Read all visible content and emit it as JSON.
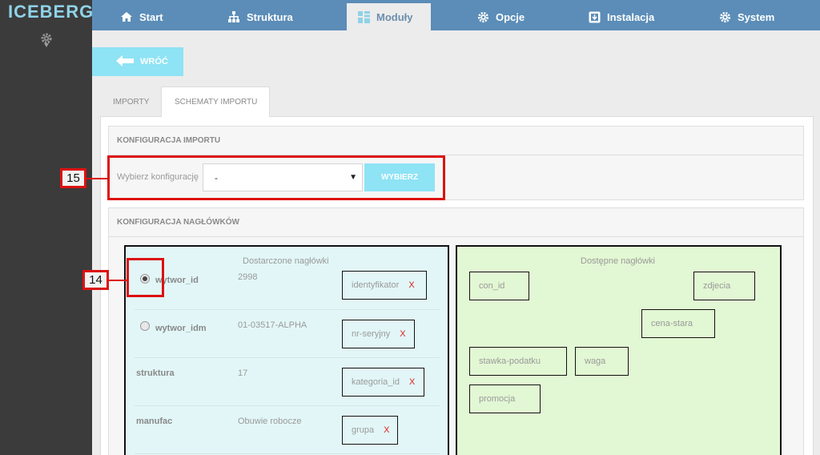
{
  "sidebar": {
    "logo": "ICEBERG",
    "icon": "gear-icon"
  },
  "nav": {
    "items": [
      {
        "label": "Start",
        "icon": "home-icon"
      },
      {
        "label": "Struktura",
        "icon": "sitemap-icon"
      },
      {
        "label": "Moduły",
        "icon": "grid-icon",
        "active": true
      },
      {
        "label": "Opcje",
        "icon": "gear-icon"
      },
      {
        "label": "Instalacja",
        "icon": "install-icon"
      },
      {
        "label": "System",
        "icon": "gear-icon"
      }
    ]
  },
  "back": {
    "label": "WRÓĆ"
  },
  "tabs": [
    {
      "label": "IMPORTY"
    },
    {
      "label": "SCHEMATY IMPORTU",
      "active": true
    }
  ],
  "import_config": {
    "title": "KONFIGURACJA IMPORTU",
    "select_label": "Wybierz konfigurację",
    "select_value": "-",
    "button_label": "WYBIERZ"
  },
  "headers_config": {
    "title": "KONFIGURACJA NAGŁÓWKÓW",
    "provided_title": "Dostarczone nagłówki",
    "available_title": "Dostępne nagłówki",
    "provided_rows": [
      {
        "name": "wytwor_id",
        "value": "2998",
        "chip": "identyfikator",
        "radio": true,
        "checked": true
      },
      {
        "name": "wytwor_idm",
        "value": "01-03517-ALPHA",
        "chip": "nr-seryjny",
        "radio": true,
        "checked": false
      },
      {
        "name": "struktura",
        "value": "17",
        "chip": "kategoria_id",
        "radio": false
      },
      {
        "name": "manufac",
        "value": "Obuwie robocze",
        "chip": "grupa",
        "radio": false
      }
    ],
    "chip_remove": "X",
    "available_chips": [
      "con_id",
      "zdjecia",
      "cena-stara",
      "stawka-podatku",
      "waga",
      "promocja"
    ]
  },
  "callouts": {
    "select": "15",
    "radio": "14"
  },
  "colors": {
    "nav": "#5b8db8",
    "accent": "#8ee3f5",
    "sidebar": "#3b3b3b",
    "highlight": "#dd1111",
    "provided_bg": "#e2f6f7",
    "available_bg": "#e2f7d3"
  }
}
